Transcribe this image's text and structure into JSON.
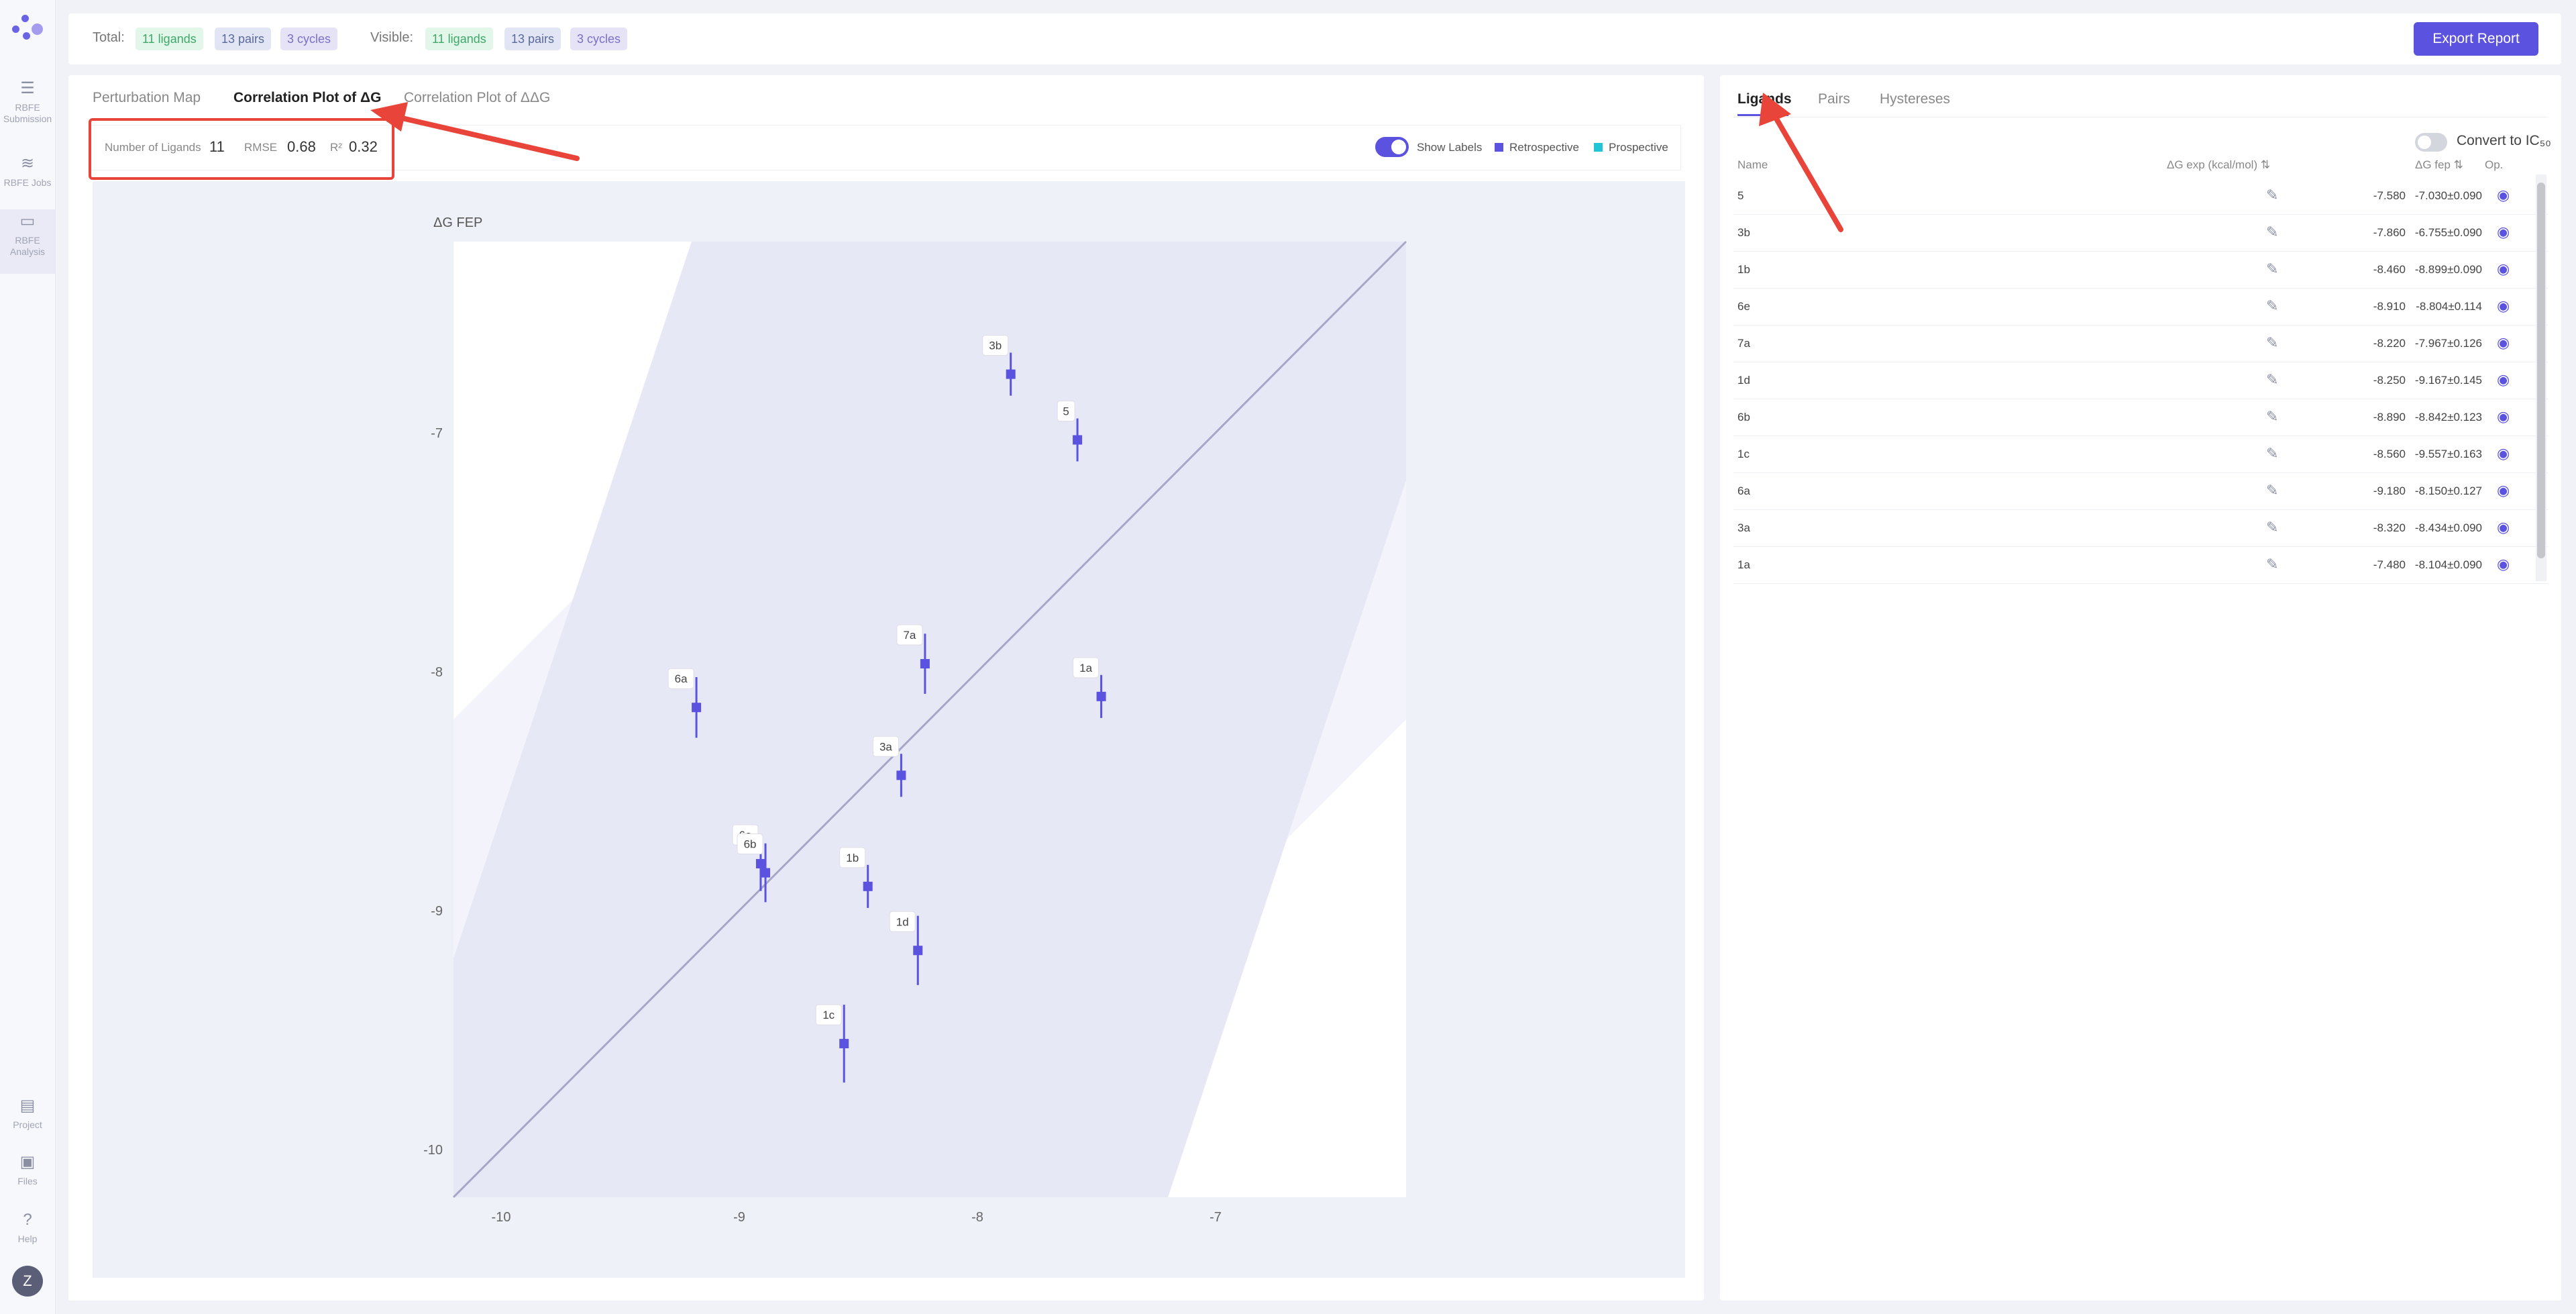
{
  "sidebar": {
    "items": [
      {
        "label": "RBFE Submission"
      },
      {
        "label": "RBFE Jobs"
      },
      {
        "label": "RBFE Analysis"
      },
      {
        "label": "Project"
      },
      {
        "label": "Files"
      },
      {
        "label": "Help"
      }
    ],
    "avatar": "Z"
  },
  "topbar": {
    "total_label": "Total:",
    "total_ligands": "11 ligands",
    "total_pairs": "13 pairs",
    "total_cycles": "3 cycles",
    "visible_label": "Visible:",
    "visible_ligands": "11 ligands",
    "visible_pairs": "13 pairs",
    "visible_cycles": "3 cycles",
    "export_label": "Export Report"
  },
  "left": {
    "tabs": [
      "Perturbation Map",
      "Correlation Plot of ΔG",
      "Correlation Plot of ΔΔG"
    ],
    "stats": {
      "ligands_label": "Number of Ligands",
      "ligands_value": "11",
      "rmse_label": "RMSE",
      "rmse_value": "0.68",
      "r2_label": "R²",
      "r2_value": "0.32"
    },
    "show_labels": "Show Labels",
    "legend": [
      "Retrospective",
      "Prospective"
    ]
  },
  "colors": {
    "accent": "#5b52e0",
    "retrospective": "#5b52e0",
    "prospective": "#22c5d4",
    "annotation": "#e8443a"
  },
  "chart_data": {
    "type": "scatter",
    "ylabel": "ΔG FEP",
    "xlabel": "",
    "xlim": [
      -10.2,
      -6.2
    ],
    "ylim": [
      -10.2,
      -6.2
    ],
    "xticks": [
      "-10",
      "-9",
      "-8",
      "-7"
    ],
    "yticks": [
      "-7",
      "-8",
      "-9",
      "-10"
    ],
    "diagonal": true,
    "band": [
      1,
      2
    ],
    "series": [
      {
        "name": "Retrospective",
        "points": [
          {
            "label": "5",
            "x": -7.58,
            "y": -7.03,
            "err": 0.09
          },
          {
            "label": "3b",
            "x": -7.86,
            "y": -6.755,
            "err": 0.09
          },
          {
            "label": "1b",
            "x": -8.46,
            "y": -8.899,
            "err": 0.09
          },
          {
            "label": "6e",
            "x": -8.91,
            "y": -8.804,
            "err": 0.114
          },
          {
            "label": "7a",
            "x": -8.22,
            "y": -7.967,
            "err": 0.126
          },
          {
            "label": "1d",
            "x": -8.25,
            "y": -9.167,
            "err": 0.145
          },
          {
            "label": "6b",
            "x": -8.89,
            "y": -8.842,
            "err": 0.123
          },
          {
            "label": "1c",
            "x": -8.56,
            "y": -9.557,
            "err": 0.163
          },
          {
            "label": "6a",
            "x": -9.18,
            "y": -8.15,
            "err": 0.127
          },
          {
            "label": "3a",
            "x": -8.32,
            "y": -8.434,
            "err": 0.09
          },
          {
            "label": "1a",
            "x": -7.48,
            "y": -8.104,
            "err": 0.09
          }
        ]
      }
    ]
  },
  "right": {
    "tabs": [
      "Ligands",
      "Pairs",
      "Hystereses"
    ],
    "convert_label": "Convert to IC₅₀",
    "columns": [
      "Name",
      "ΔG exp (kcal/mol)",
      "ΔG fep",
      "Op."
    ],
    "rows": [
      {
        "name": "5",
        "exp": "-7.580",
        "fep": "-7.030±0.090"
      },
      {
        "name": "3b",
        "exp": "-7.860",
        "fep": "-6.755±0.090"
      },
      {
        "name": "1b",
        "exp": "-8.460",
        "fep": "-8.899±0.090"
      },
      {
        "name": "6e",
        "exp": "-8.910",
        "fep": "-8.804±0.114"
      },
      {
        "name": "7a",
        "exp": "-8.220",
        "fep": "-7.967±0.126"
      },
      {
        "name": "1d",
        "exp": "-8.250",
        "fep": "-9.167±0.145"
      },
      {
        "name": "6b",
        "exp": "-8.890",
        "fep": "-8.842±0.123"
      },
      {
        "name": "1c",
        "exp": "-8.560",
        "fep": "-9.557±0.163"
      },
      {
        "name": "6a",
        "exp": "-9.180",
        "fep": "-8.150±0.127"
      },
      {
        "name": "3a",
        "exp": "-8.320",
        "fep": "-8.434±0.090"
      },
      {
        "name": "1a",
        "exp": "-7.480",
        "fep": "-8.104±0.090"
      }
    ]
  }
}
